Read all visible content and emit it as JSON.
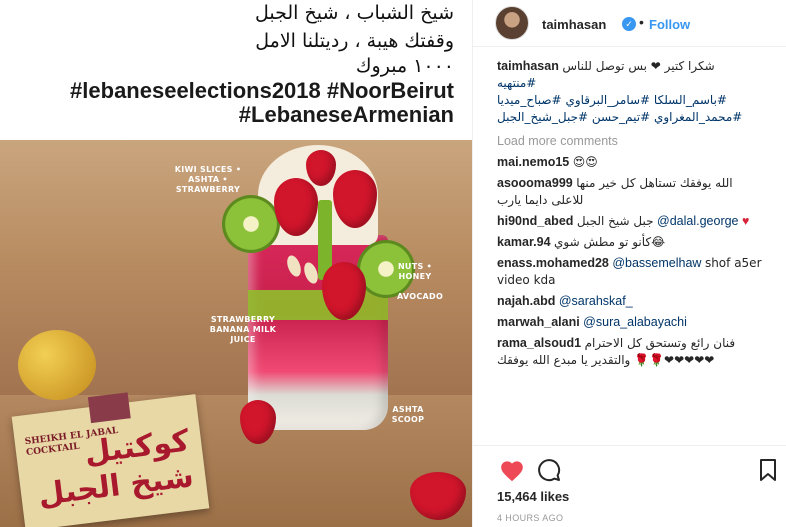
{
  "post_image": {
    "caption_lines": [
      "شيخ الشباب ، شيخ الجبل",
      "وقفتك هيبة ، رديتلنا الامل",
      "١٠٠٠ مبروك",
      "#lebaneseelections2018 #NoorBeirut",
      "#LebaneseArmenian"
    ],
    "annotations": [
      "KIWI SLICES • ASHTA • STRAWBERRY",
      "NUTS • HONEY",
      "AVOCADO",
      "STRAWBERRY BANANA MILK JUICE",
      "ASHTA SCOOP"
    ],
    "label_en": [
      "SHEIKH EL JABAL",
      "COCKTAIL"
    ],
    "label_ar": "كوكتيل شيخ الجبل"
  },
  "header": {
    "username": "taimhasan",
    "separator": "•",
    "follow_label": "Follow"
  },
  "caption": {
    "user": "taimhasan",
    "text": "شكرا كتير ❤ بس توصل للناس",
    "hashtags": [
      "#منتهيه",
      "#باسم_السلكا",
      "#سامر_البرقاوي",
      "#صباح_ميديا",
      "#محمد_المغراوي",
      "#تيم_حسن",
      "#جبل_شيخ_الجبل"
    ]
  },
  "load_more_label": "Load more comments",
  "comments": [
    {
      "user": "mai.nemo15",
      "text": "😍😍"
    },
    {
      "user": "asoooma999",
      "text": "الله يوفقك تستاهل كل خير منها للاعلى دايما يارب"
    },
    {
      "user": "hi90nd_abed",
      "text": "جبل شيخ الجبل",
      "mention": "@dalal.george"
    },
    {
      "user": "kamar.94",
      "text": "كأنو تو مطش شوي😂"
    },
    {
      "user": "enass.mohamed28",
      "mention": "@bassemelhaw",
      "text": "shof a5er video kda"
    },
    {
      "user": "najah.abd",
      "mention": "@sarahskaf_"
    },
    {
      "user": "marwah_alani",
      "mention": "@sura_alabayachi"
    },
    {
      "user": "rama_alsoud1",
      "text": "فنان رائع وتستحق كل الاحترام والتقدير يا مبدع الله يوفقك 🌹🌹❤❤❤❤❤"
    }
  ],
  "likes": "15,464 likes",
  "timestamp": "4 HOURS AGO",
  "icons": {
    "like": "heart-icon",
    "comment": "comment-icon",
    "save": "bookmark-icon",
    "verified": "verified-badge-icon"
  },
  "colors": {
    "link": "#003569",
    "follow": "#3897f0",
    "heart": "#ed4956",
    "muted": "#999999"
  }
}
